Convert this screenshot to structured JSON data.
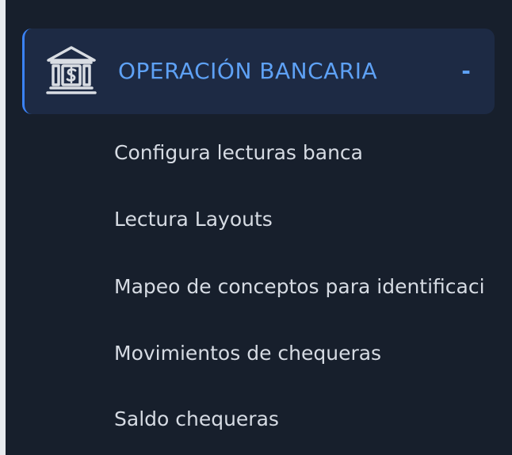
{
  "section": {
    "icon": "bank-icon",
    "title": "OPERACIÓN BANCARIA",
    "toggle": "-",
    "accent_color": "#5ea1f5",
    "border_color": "#3b82f6"
  },
  "menu": {
    "items": [
      {
        "label": "Configura lecturas banca"
      },
      {
        "label": "Lectura Layouts"
      },
      {
        "label": "Mapeo de conceptos para identificaci"
      },
      {
        "label": "Movimientos de chequeras"
      },
      {
        "label": "Saldo chequeras"
      }
    ]
  }
}
